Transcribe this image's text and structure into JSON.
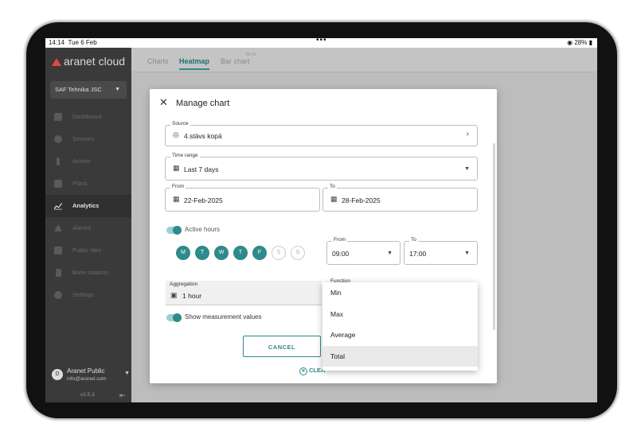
{
  "status_bar": {
    "time": "14:14",
    "date": "Tue 6 Feb",
    "dots": "•••",
    "right": "28%"
  },
  "sidebar": {
    "logo": "aranet cloud",
    "org": "SAF Tehnika JSC",
    "items": [
      {
        "label": "Dashboard",
        "icon": "dashboard-icon"
      },
      {
        "label": "Sensors",
        "icon": "sensor-icon"
      },
      {
        "label": "Assets",
        "icon": "asset-icon"
      },
      {
        "label": "Plans",
        "icon": "plan-icon"
      },
      {
        "label": "Analytics",
        "icon": "chart-line-icon",
        "active": true
      },
      {
        "label": "Alarms",
        "icon": "alarm-icon"
      },
      {
        "label": "Public tiles",
        "icon": "tile-icon"
      },
      {
        "label": "Base stations",
        "icon": "base-station-icon"
      },
      {
        "label": "Settings",
        "icon": "gear-icon"
      }
    ],
    "user": {
      "initial": "D",
      "name": "Aranet Public",
      "email": "info@aranet.com"
    },
    "version": "v2.5.3"
  },
  "tabs": [
    {
      "label": "Charts"
    },
    {
      "label": "Heatmap",
      "active": true
    },
    {
      "label": "Bar chart",
      "badge": "BETA"
    }
  ],
  "modal": {
    "title": "Manage chart",
    "source": {
      "label": "Source",
      "value": "4.stāvs kopā"
    },
    "time_range": {
      "label": "Time range",
      "value": "Last 7 days"
    },
    "from": {
      "label": "From",
      "value": "22-Feb-2025"
    },
    "to": {
      "label": "To",
      "value": "28-Feb-2025"
    },
    "active_hours": {
      "label": "Active hours",
      "enabled": true
    },
    "days": [
      {
        "label": "M",
        "on": true
      },
      {
        "label": "T",
        "on": true
      },
      {
        "label": "W",
        "on": true
      },
      {
        "label": "T",
        "on": true
      },
      {
        "label": "F",
        "on": true
      },
      {
        "label": "S",
        "on": false
      },
      {
        "label": "S",
        "on": false
      }
    ],
    "hours_from": {
      "label": "From",
      "value": "09:00"
    },
    "hours_to": {
      "label": "To",
      "value": "17:00"
    },
    "aggregation": {
      "label": "Aggregation",
      "value": "1 hour"
    },
    "function": {
      "label": "Function"
    },
    "show_values": {
      "label": "Show measurement values",
      "enabled": true
    },
    "cancel_label": "CANCEL",
    "clear_label": "CLEA"
  },
  "function_dropdown": {
    "options": [
      "Min",
      "Max",
      "Average",
      "Total"
    ],
    "highlighted": "Total"
  },
  "colors": {
    "accent": "#2f8a8c",
    "sidebar": "#3a3a3a",
    "logo_red": "#e0483e"
  }
}
